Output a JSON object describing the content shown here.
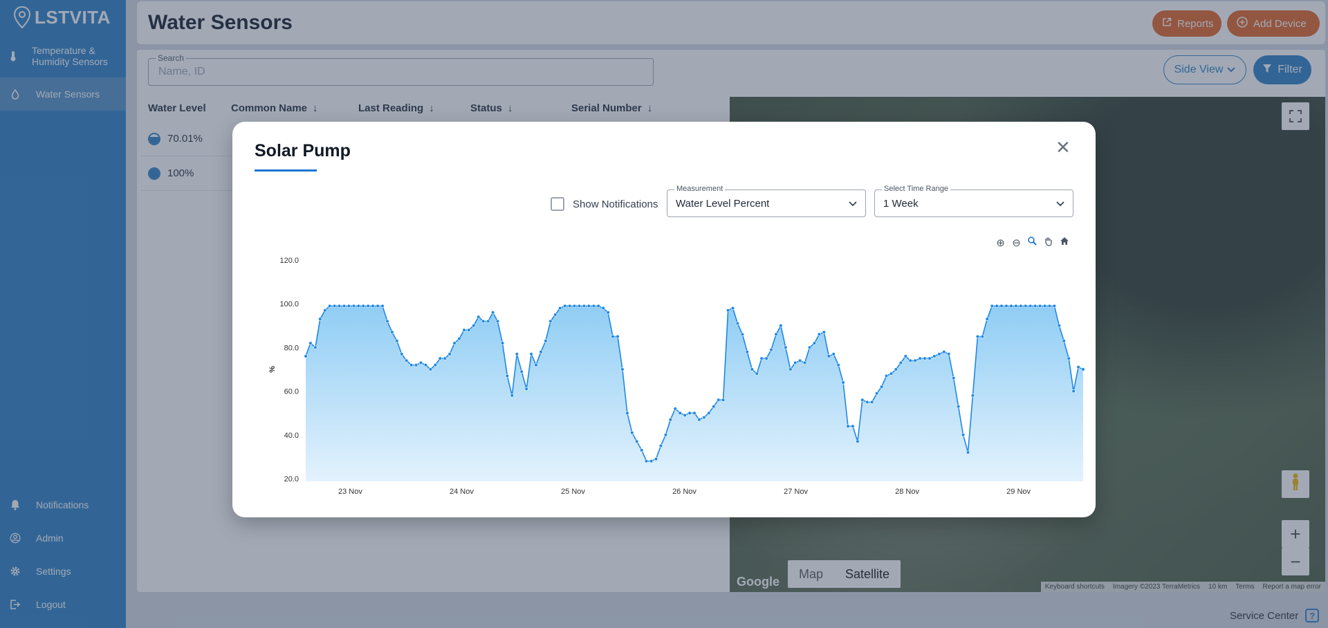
{
  "app": {
    "logo_text": "LSTVITA"
  },
  "sidebar": {
    "items": [
      {
        "label": "Temperature & Humidity Sensors",
        "icon": "thermometer-icon"
      },
      {
        "label": "Water Sensors",
        "icon": "water-drop-icon",
        "active": true
      }
    ],
    "bottom_items": [
      {
        "label": "Notifications",
        "icon": "bell-icon"
      },
      {
        "label": "Admin",
        "icon": "user-circle-icon"
      },
      {
        "label": "Settings",
        "icon": "gear-icon"
      },
      {
        "label": "Logout",
        "icon": "logout-icon"
      }
    ]
  },
  "header": {
    "title": "Water Sensors",
    "reports_label": "Reports",
    "add_device_label": "Add Device"
  },
  "toolbar": {
    "search_label": "Search",
    "search_placeholder": "Name, ID",
    "side_view_label": "Side View",
    "filter_label": "Filter"
  },
  "table": {
    "columns": [
      "Water Level",
      "Common Name",
      "Last Reading",
      "Status",
      "Serial Number"
    ],
    "rows": [
      {
        "water_level": "70.01%",
        "fill": 0.7001
      },
      {
        "water_level": "100%",
        "fill": 1.0
      }
    ]
  },
  "map": {
    "map_label": "Map",
    "satellite_label": "Satellite",
    "google_label": "Google",
    "attribution": [
      "Keyboard shortcuts",
      "Imagery ©2023 TerraMetrics",
      "10 km",
      "Terms",
      "Report a map error"
    ]
  },
  "footer": {
    "service_center": "Service Center"
  },
  "modal": {
    "title": "Solar Pump",
    "show_notifications_label": "Show Notifications",
    "measurement": {
      "label": "Measurement",
      "value": "Water Level Percent"
    },
    "time_range": {
      "label": "Select Time Range",
      "value": "1 Week"
    }
  },
  "colors": {
    "sidebar": "#2a7ec4",
    "accent_orange": "#e3611f",
    "series": "#1e88e5"
  },
  "chart_data": {
    "type": "area",
    "title": "",
    "xlabel": "",
    "ylabel": "%",
    "ylim": [
      20,
      120
    ],
    "yticks": [
      "120.0",
      "100.0",
      "80.0",
      "60.0",
      "40.0",
      "20.0"
    ],
    "xticks": [
      "23 Nov",
      "24 Nov",
      "25 Nov",
      "26 Nov",
      "27 Nov",
      "28 Nov",
      "29 Nov"
    ],
    "x_start_day": 22.6,
    "x_end_day": 29.58,
    "series": [
      {
        "values": [
          76,
          82,
          80,
          93,
          97,
          99,
          99,
          99,
          99,
          99,
          99,
          99,
          99,
          99,
          99,
          99,
          99,
          92,
          87,
          83,
          77,
          74,
          72,
          72,
          73,
          72,
          70,
          72,
          75,
          75,
          77,
          82,
          84,
          88,
          88,
          90,
          94,
          92,
          92,
          96,
          92,
          82,
          67,
          58,
          77,
          69,
          61,
          77,
          72,
          78,
          83,
          92,
          95,
          98,
          99,
          99,
          99,
          99,
          99,
          99,
          99,
          99,
          98,
          96,
          85,
          85,
          70,
          50,
          41,
          37,
          33,
          28,
          28,
          29,
          35,
          40,
          47,
          52,
          50,
          49,
          50,
          50,
          47,
          48,
          50,
          53,
          56,
          56,
          97,
          98,
          91,
          86,
          78,
          70,
          68,
          75,
          75,
          79,
          86,
          90,
          80,
          70,
          73,
          74,
          73,
          80,
          82,
          86,
          87,
          76,
          77,
          72,
          64,
          44,
          44,
          37,
          56,
          55,
          55,
          59,
          62,
          67,
          68,
          70,
          73,
          76,
          74,
          74,
          75,
          75,
          75,
          76,
          77,
          78,
          77,
          66,
          53,
          40,
          32,
          58,
          85,
          85,
          93,
          99,
          99,
          99,
          99,
          99,
          99,
          99,
          99,
          99,
          99,
          99,
          99,
          99,
          99,
          90,
          83,
          75,
          60,
          71,
          70
        ]
      }
    ]
  }
}
